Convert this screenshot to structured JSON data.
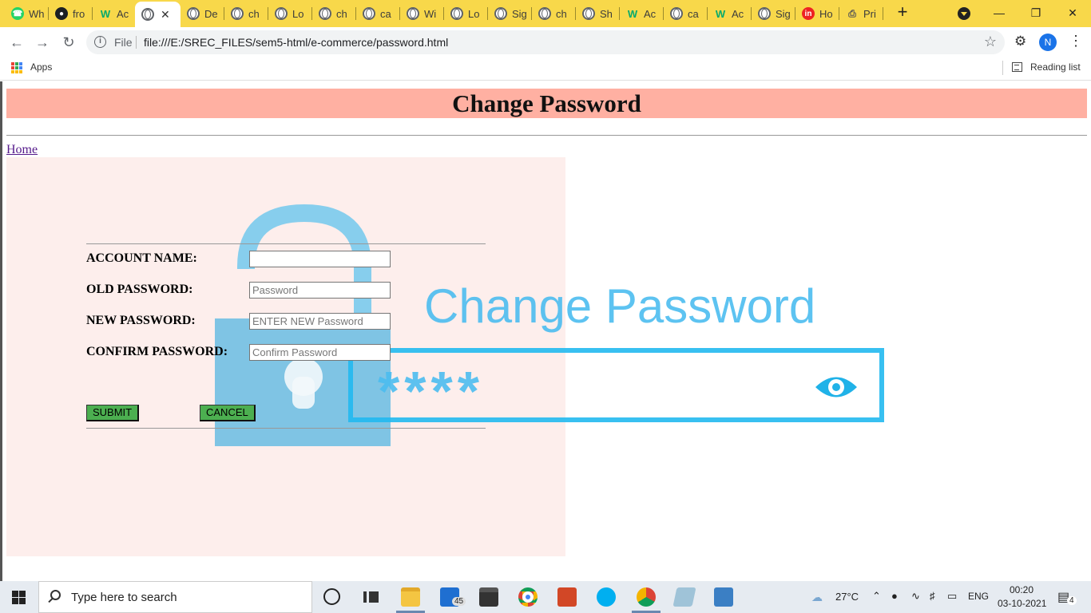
{
  "browser": {
    "tabs": [
      {
        "label": "Wh",
        "favicon": "whatsapp-icon"
      },
      {
        "label": "fro",
        "favicon": "github-icon"
      },
      {
        "label": "Ac",
        "favicon": "w3schools-icon"
      },
      {
        "label": "",
        "favicon": "globe-icon",
        "active": true
      },
      {
        "label": "De",
        "favicon": "globe-icon"
      },
      {
        "label": "ch",
        "favicon": "globe-icon"
      },
      {
        "label": "Lo",
        "favicon": "globe-icon"
      },
      {
        "label": "ch",
        "favicon": "globe-icon"
      },
      {
        "label": "ca",
        "favicon": "globe-icon"
      },
      {
        "label": "Wi",
        "favicon": "globe-icon"
      },
      {
        "label": "Lo",
        "favicon": "globe-icon"
      },
      {
        "label": "Sig",
        "favicon": "globe-icon"
      },
      {
        "label": "ch",
        "favicon": "globe-icon"
      },
      {
        "label": "Sh",
        "favicon": "globe-icon"
      },
      {
        "label": "Ac",
        "favicon": "w3schools-icon"
      },
      {
        "label": "ca",
        "favicon": "globe-icon"
      },
      {
        "label": "Ac",
        "favicon": "w3schools-icon"
      },
      {
        "label": "Sig",
        "favicon": "globe-icon"
      },
      {
        "label": "Ho",
        "favicon": "invision-icon"
      },
      {
        "label": "Pri",
        "favicon": "printer-icon"
      }
    ],
    "new_tab_label": "+",
    "address": {
      "scheme": "File",
      "url": "file:///E:/SREC_FILES/sem5-html/e-commerce/password.html"
    },
    "profile_initial": "N",
    "bookmarks": {
      "apps_label": "Apps",
      "reading_list_label": "Reading list"
    },
    "colors": {
      "tabstrip": "#f8d84a"
    }
  },
  "page": {
    "title": "Change Password",
    "home_link": "Home",
    "art": {
      "heading": "Change Password",
      "mask": "****"
    },
    "form": {
      "fields": [
        {
          "label": "ACCOUNT NAME:",
          "value": "",
          "placeholder": ""
        },
        {
          "label": "OLD PASSWORD:",
          "value": "",
          "placeholder": "Password"
        },
        {
          "label": "NEW PASSWORD:",
          "value": "",
          "placeholder": "ENTER NEW Password"
        },
        {
          "label": "CONFIRM PASSWORD:",
          "value": "",
          "placeholder": "Confirm Password"
        }
      ],
      "submit_label": "SUBMIT",
      "cancel_label": "CANCEL"
    },
    "colors": {
      "banner": "#ffb0a2",
      "form_bg": "#fdeeec",
      "button": "#4caf50",
      "art": "#7cc8e8"
    }
  },
  "taskbar": {
    "search_placeholder": "Type here to search",
    "mail_badge": "45",
    "temperature": "27°C",
    "language": "ENG",
    "time": "00:20",
    "date": "03-10-2021",
    "notification_count": "4"
  }
}
